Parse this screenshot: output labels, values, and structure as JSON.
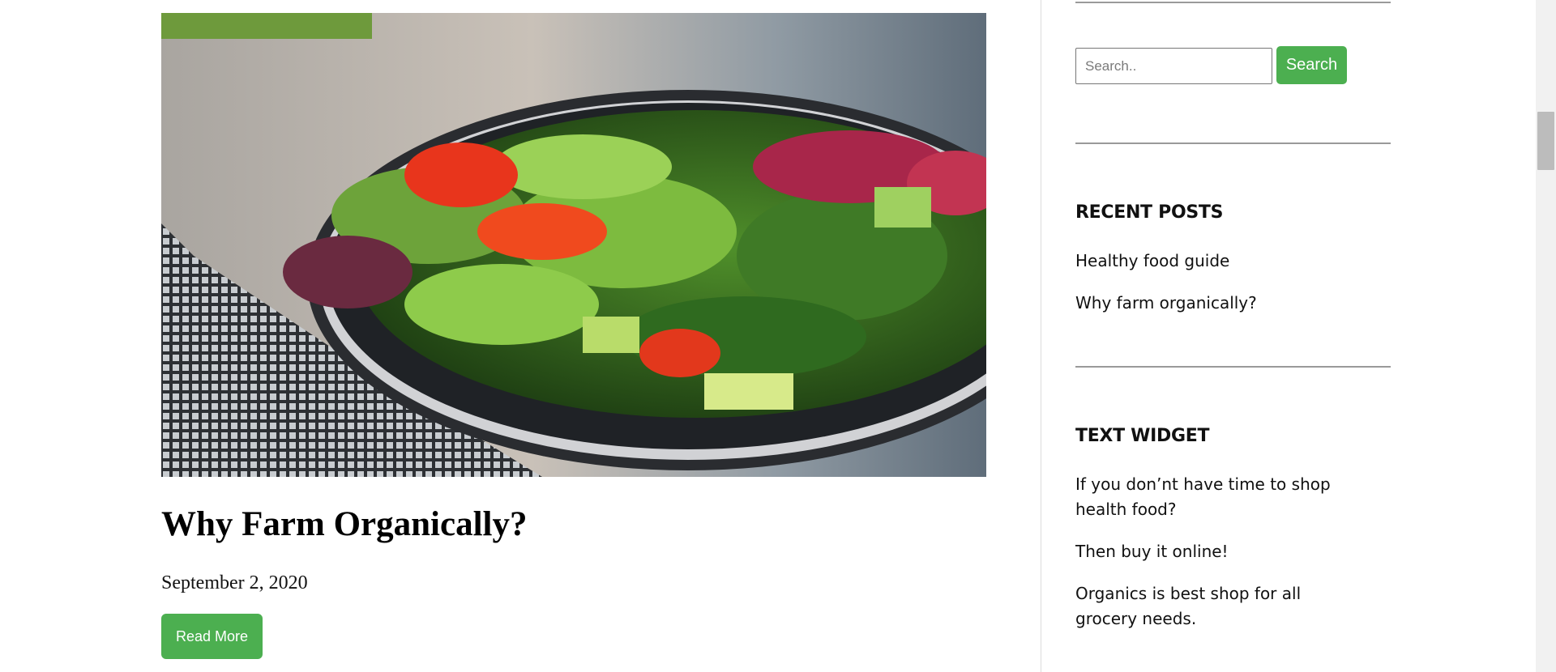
{
  "post": {
    "title": "Why Farm Organically?",
    "date": "September 2, 2020",
    "read_more_label": "Read More",
    "image_description_icon": "salad-bowl-image"
  },
  "sidebar": {
    "search": {
      "placeholder": "Search..",
      "value": "",
      "button_label": "Search"
    },
    "recent_posts": {
      "title": "RECENT POSTS",
      "items": [
        {
          "label": "Healthy food guide"
        },
        {
          "label": "Why farm organically?"
        }
      ]
    },
    "text_widget": {
      "title": "TEXT WIDGET",
      "paragraphs": [
        "If you don’nt have time to shop health food?",
        "Then buy it online!",
        "Organics is best shop for all grocery needs."
      ]
    }
  },
  "colors": {
    "accent": "#4caf50",
    "text": "#111111",
    "rule": "#9a9a9a"
  }
}
